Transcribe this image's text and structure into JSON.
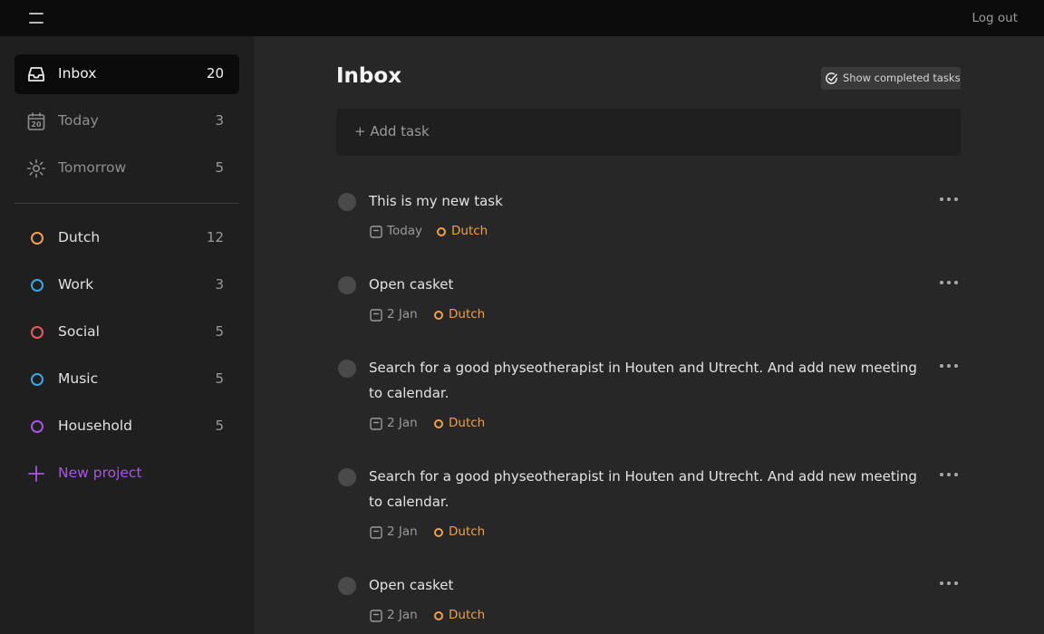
{
  "header": {
    "menu_icon": "hamburger-icon",
    "logout_label": "Log out"
  },
  "sidebar": {
    "nav": [
      {
        "label": "Inbox",
        "count": "20",
        "icon": "inbox-icon",
        "active": true
      },
      {
        "label": "Today",
        "count": "3",
        "icon": "calendar-20-icon",
        "calendar_day": "20"
      },
      {
        "label": "Tomorrow",
        "count": "5",
        "icon": "sun-icon"
      }
    ],
    "projects": [
      {
        "label": "Dutch",
        "count": "12",
        "color": "#f0a04b"
      },
      {
        "label": "Work",
        "count": "3",
        "color": "#3aa7e0"
      },
      {
        "label": "Social",
        "count": "5",
        "color": "#e65a5a"
      },
      {
        "label": "Music",
        "count": "5",
        "color": "#3aa7e0"
      },
      {
        "label": "Household",
        "count": "5",
        "color": "#a856e0"
      }
    ],
    "new_project_label": "New project",
    "new_project_color": "#a856e0"
  },
  "main": {
    "title": "Inbox",
    "show_completed_label": "Show completed tasks",
    "add_task_label": "+ Add task",
    "tasks": [
      {
        "title": "This is my new task",
        "date": "Today",
        "project": "Dutch"
      },
      {
        "title": "Open casket",
        "date": "2 Jan",
        "project": "Dutch"
      },
      {
        "title": "Search for a good physeotherapist in Houten and Utrecht. And add new meeting to calendar.",
        "date": "2 Jan",
        "project": "Dutch"
      },
      {
        "title": "Search for a good physeotherapist in Houten and Utrecht. And add new meeting to calendar.",
        "date": "2 Jan",
        "project": "Dutch"
      },
      {
        "title": "Open casket",
        "date": "2 Jan",
        "project": "Dutch"
      }
    ]
  }
}
